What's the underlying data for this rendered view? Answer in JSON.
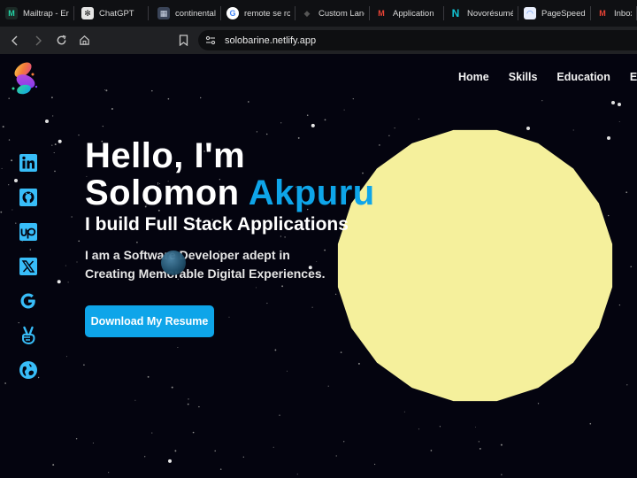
{
  "browser": {
    "tabs": [
      {
        "label": "Mailtrap - Er",
        "icon": "mailtrap-icon",
        "color": "#22d3a5"
      },
      {
        "label": "ChatGPT",
        "icon": "chatgpt-icon",
        "color": "#e5e5e5"
      },
      {
        "label": "continental_",
        "icon": "continental-icon",
        "color": "#7a8aa8"
      },
      {
        "label": "remote se rc",
        "icon": "google-icon",
        "color": "#4285f4"
      },
      {
        "label": "Custom Lanc",
        "icon": "custom-icon",
        "color": "#111111"
      },
      {
        "label": "Application",
        "icon": "gmail-icon",
        "color": "#ea4335"
      },
      {
        "label": "Novorésumé",
        "icon": "novoresume-icon",
        "color": "#12c4d4"
      },
      {
        "label": "PageSpeed",
        "icon": "pagespeed-icon",
        "color": "#4a8af4"
      },
      {
        "label": "Inbox (",
        "icon": "gmail-icon",
        "color": "#ea4335"
      }
    ],
    "url": "solobarine.netlify.app"
  },
  "nav": {
    "items": [
      "Home",
      "Skills",
      "Education",
      "Exp"
    ]
  },
  "socials": [
    {
      "name": "linkedin-icon"
    },
    {
      "name": "github-icon"
    },
    {
      "name": "upwork-icon"
    },
    {
      "name": "x-twitter-icon"
    },
    {
      "name": "google-icon"
    },
    {
      "name": "peace-hand-icon"
    },
    {
      "name": "globe-icon"
    }
  ],
  "hero": {
    "line1": "Hello, I'm",
    "first_name": "Solomon",
    "last_name": "Akpuru",
    "tagline": "I build Full Stack Applications",
    "desc_line1": "I am a Software Developer adept in",
    "desc_line2": "Creating Memorable Digital Experiences.",
    "cta_label": "Download My Resume"
  },
  "colors": {
    "accent": "#0ea5e9",
    "background": "#04040f",
    "sun": "#f5f09c"
  }
}
